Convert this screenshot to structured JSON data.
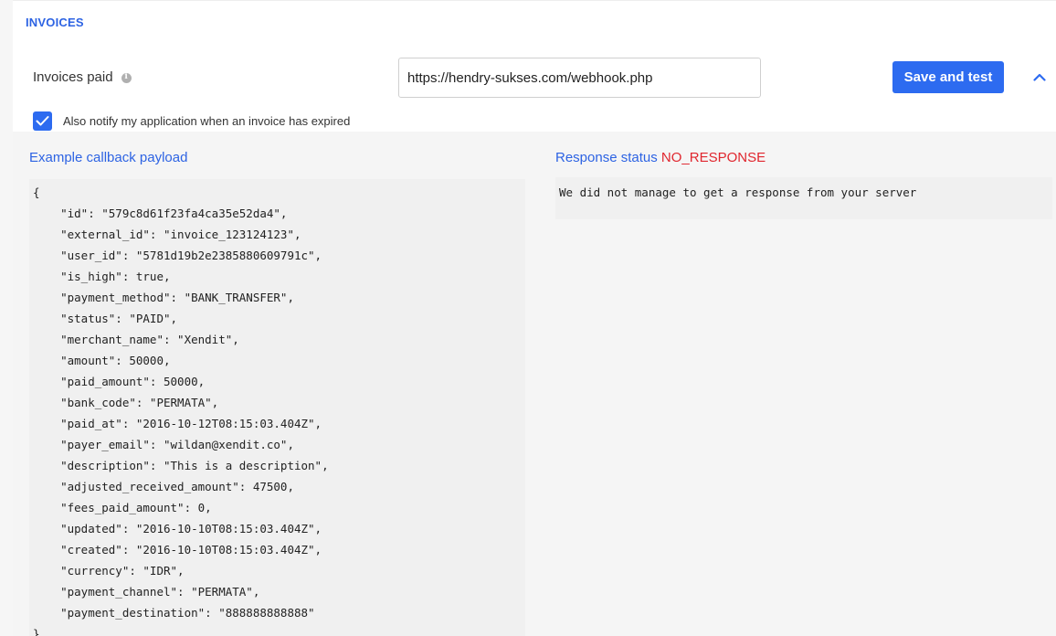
{
  "section": {
    "title": "INVOICES"
  },
  "webhook": {
    "label": "Invoices paid",
    "url_value": "https://hendry-sukses.com/webhook.php",
    "save_label": "Save and test"
  },
  "notify": {
    "checked": true,
    "label": "Also notify my application when an invoice has expired"
  },
  "payload": {
    "title": "Example callback payload",
    "lines": [
      "{",
      "    \"id\": \"579c8d61f23fa4ca35e52da4\",",
      "    \"external_id\": \"invoice_123124123\",",
      "    \"user_id\": \"5781d19b2e2385880609791c\",",
      "    \"is_high\": true,",
      "    \"payment_method\": \"BANK_TRANSFER\",",
      "    \"status\": \"PAID\",",
      "    \"merchant_name\": \"Xendit\",",
      "    \"amount\": 50000,",
      "    \"paid_amount\": 50000,",
      "    \"bank_code\": \"PERMATA\",",
      "    \"paid_at\": \"2016-10-12T08:15:03.404Z\",",
      "    \"payer_email\": \"wildan@xendit.co\",",
      "    \"description\": \"This is a description\",",
      "    \"adjusted_received_amount\": 47500,",
      "    \"fees_paid_amount\": 0,",
      "    \"updated\": \"2016-10-10T08:15:03.404Z\",",
      "    \"created\": \"2016-10-10T08:15:03.404Z\",",
      "    \"currency\": \"IDR\",",
      "    \"payment_channel\": \"PERMATA\",",
      "    \"payment_destination\": \"888888888888\"",
      "}"
    ]
  },
  "response": {
    "title": "Response status",
    "status": "NO_RESPONSE",
    "message": "We did not manage to get a response from your server"
  },
  "colors": {
    "accent": "#2d6bf0",
    "link": "#2d63e3",
    "error": "#e0262e"
  },
  "icons": {
    "info": "info-icon",
    "collapse": "chevron-up-icon",
    "check": "check-icon"
  }
}
